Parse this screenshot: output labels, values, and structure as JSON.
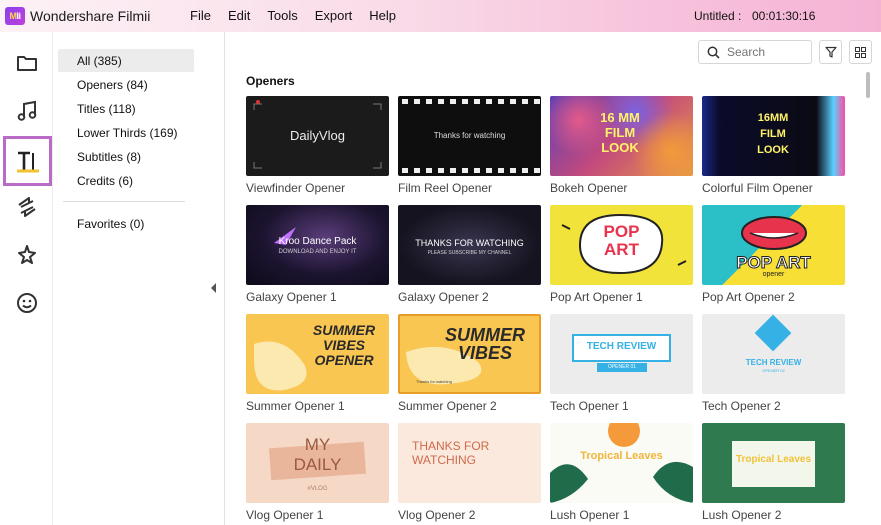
{
  "app": {
    "logo_text": "Mli",
    "title": "Wondershare Filmii"
  },
  "menu": [
    "File",
    "Edit",
    "Tools",
    "Export",
    "Help"
  ],
  "project": {
    "name": "Untitled :",
    "timecode": "00:01:30:16"
  },
  "rail": [
    "folder-icon",
    "music-icon",
    "titles-icon",
    "transition-icon",
    "effects-icon",
    "sticker-icon"
  ],
  "categories": {
    "items": [
      {
        "label": "All (385)",
        "selected": true
      },
      {
        "label": "Openers (84)"
      },
      {
        "label": "Titles (118)"
      },
      {
        "label": "Lower Thirds (169)"
      },
      {
        "label": "Subtitles (8)"
      },
      {
        "label": "Credits (6)"
      }
    ],
    "favorites": "Favorites (0)"
  },
  "search": {
    "placeholder": "Search"
  },
  "section": "Openers",
  "cards": [
    {
      "label": "Viewfinder Opener",
      "thumb_text": "DailyVlog"
    },
    {
      "label": "Film Reel Opener",
      "thumb_text": "Thanks for watching"
    },
    {
      "label": "Bokeh Opener",
      "thumb_text": "16 MM FILM LOOK"
    },
    {
      "label": "Colorful Film Opener",
      "thumb_text": "16MM FILM LOOK"
    },
    {
      "label": "Galaxy Opener 1",
      "thumb_text": "Kroo Dance Pack",
      "thumb_sub": "DOWNLOAD AND ENJOY IT"
    },
    {
      "label": "Galaxy Opener 2",
      "thumb_text": "THANKS FOR WATCHING",
      "thumb_sub": "PLEASE SUBSCRIBE MY CHANNEL"
    },
    {
      "label": "Pop Art Opener 1",
      "thumb_text": "POP ART"
    },
    {
      "label": "Pop Art Opener 2",
      "thumb_text": "POP ART",
      "thumb_sub": "opener"
    },
    {
      "label": "Summer Opener 1",
      "thumb_text": "SUMMER VIBES OPENER"
    },
    {
      "label": "Summer Opener 2",
      "thumb_text": "SUMMER VIBES",
      "thumb_sub": "Thanks for watching"
    },
    {
      "label": "Tech Opener 1",
      "thumb_text": "TECH REVIEW",
      "thumb_sub": "OPENER 01"
    },
    {
      "label": "Tech Opener 2",
      "thumb_text": "TECH REVIEW",
      "thumb_sub": "OPENER 02"
    },
    {
      "label": "Vlog Opener 1",
      "thumb_text": "MY DAILY",
      "thumb_sub": "#VLOG"
    },
    {
      "label": "Vlog Opener 2",
      "thumb_text": "THANKS FOR WATCHING",
      "thumb_mid": "FOR"
    },
    {
      "label": "Lush Opener 1",
      "thumb_text": "Tropical Leaves"
    },
    {
      "label": "Lush Opener 2",
      "thumb_text": "Tropical Leaves"
    }
  ]
}
